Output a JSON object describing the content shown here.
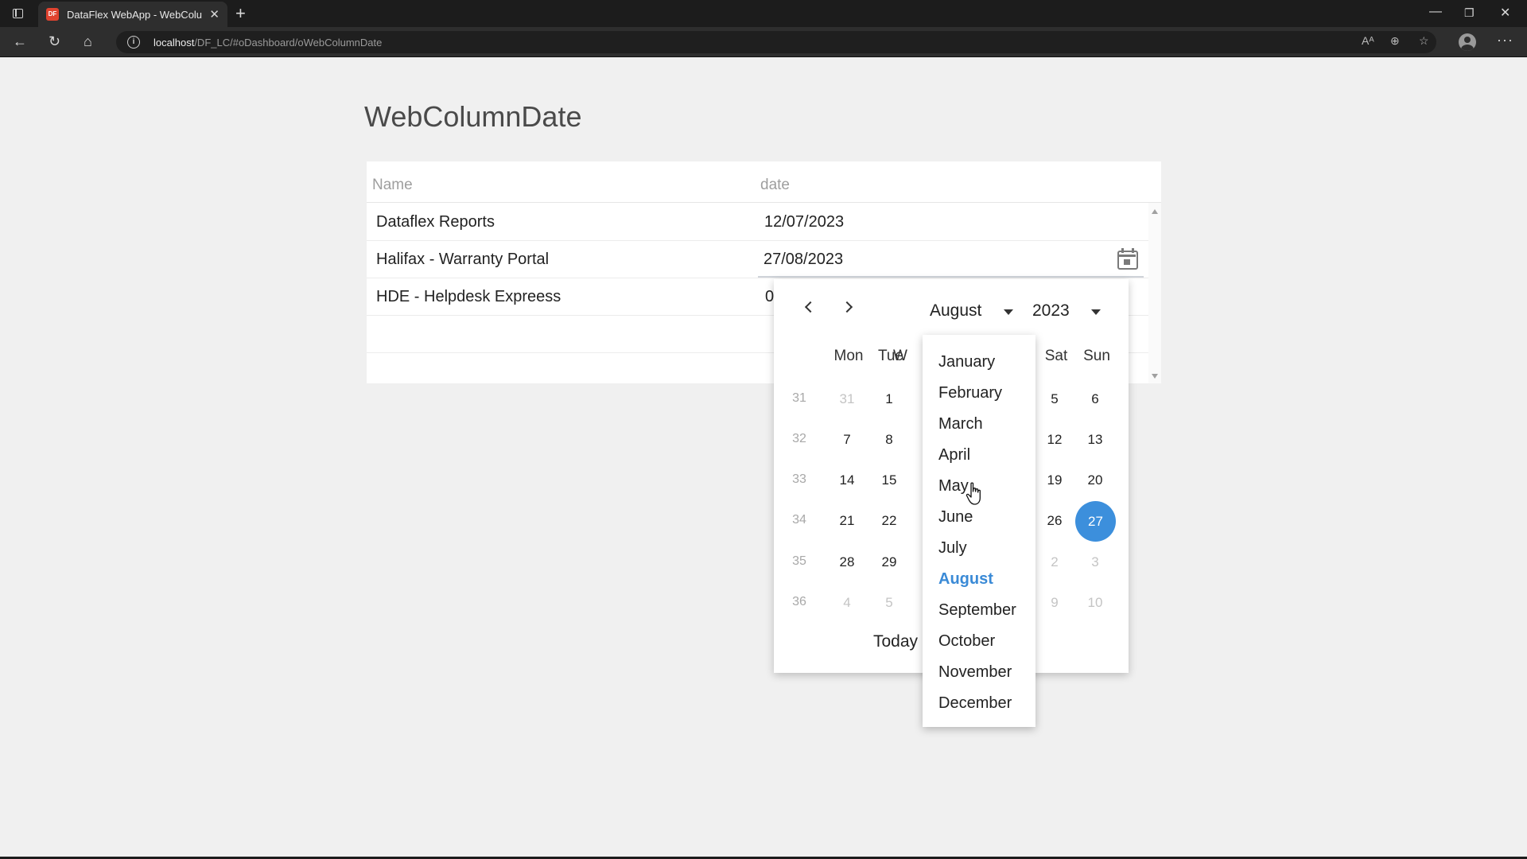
{
  "browser": {
    "tab_title": "DataFlex WebApp - WebColumn",
    "favicon_text": "DF",
    "url_host": "localhost",
    "url_path": "/DF_LC/#oDashboard/oWebColumnDate"
  },
  "page": {
    "title": "WebColumnDate"
  },
  "grid": {
    "columns": [
      "Name",
      "date"
    ],
    "rows": [
      {
        "name": "Dataflex Reports",
        "date": "12/07/2023"
      },
      {
        "name": "Halifax - Warranty Portal",
        "date": "27/08/2023"
      },
      {
        "name": "HDE - Helpdesk Expreess",
        "date": "0"
      }
    ]
  },
  "datepicker": {
    "month": "August",
    "year": "2023",
    "weekdays": [
      "Mon",
      "Tue",
      "W",
      "Sat",
      "Sun"
    ],
    "weeks": [
      {
        "wk": "31",
        "mon": "31",
        "tue": "1",
        "sat": "5",
        "sun": "6"
      },
      {
        "wk": "32",
        "mon": "7",
        "tue": "8",
        "sat": "12",
        "sun": "13"
      },
      {
        "wk": "33",
        "mon": "14",
        "tue": "15",
        "sat": "19",
        "sun": "20"
      },
      {
        "wk": "34",
        "mon": "21",
        "tue": "22",
        "sat": "26",
        "sun": "27"
      },
      {
        "wk": "35",
        "mon": "28",
        "tue": "29",
        "sat": "2",
        "sun": "3"
      },
      {
        "wk": "36",
        "mon": "4",
        "tue": "5",
        "sat": "9",
        "sun": "10"
      }
    ],
    "today_label": "Today",
    "selected_color": "#3c8fdc"
  },
  "month_dropdown": {
    "months": [
      "January",
      "February",
      "March",
      "April",
      "May",
      "June",
      "July",
      "August",
      "September",
      "October",
      "November",
      "December"
    ],
    "current": "August",
    "current_color": "#3a8ad6"
  }
}
